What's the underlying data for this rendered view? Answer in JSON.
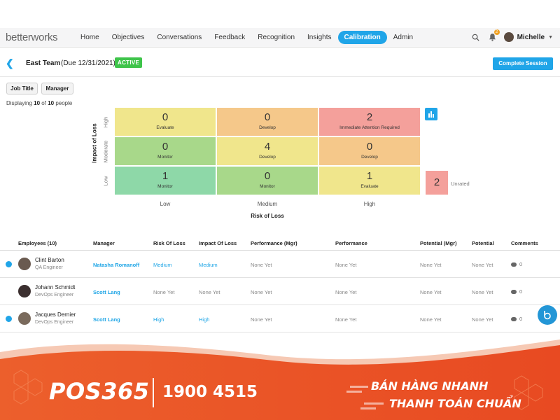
{
  "app": {
    "logo_text": "betterworks"
  },
  "nav": {
    "items": [
      {
        "label": "Home",
        "active": false
      },
      {
        "label": "Objectives",
        "active": false
      },
      {
        "label": "Conversations",
        "active": false
      },
      {
        "label": "Feedback",
        "active": false
      },
      {
        "label": "Recognition",
        "active": false
      },
      {
        "label": "Insights",
        "active": false
      },
      {
        "label": "Calibration",
        "active": true
      },
      {
        "label": "Admin",
        "active": false
      }
    ],
    "notification_count": "2",
    "user_name": "Michelle"
  },
  "session": {
    "team": "East Team",
    "due": "(Due 12/31/2021)",
    "status": "ACTIVE",
    "complete_label": "Complete Session"
  },
  "filters": {
    "job_title": "Job Title",
    "manager": "Manager"
  },
  "displaying": {
    "prefix": "Displaying",
    "shown": "10",
    "of": "of",
    "total": "10",
    "suffix": "people"
  },
  "grid": {
    "y_title": "Impact of Loss",
    "x_title": "Risk of Loss",
    "y_ticks": [
      "High",
      "Moderate",
      "Low"
    ],
    "x_ticks": [
      "Low",
      "Medium",
      "High"
    ],
    "rows": [
      [
        {
          "count": "0",
          "label": "Evaluate",
          "color": "#f0e68c"
        },
        {
          "count": "0",
          "label": "Develop",
          "color": "#f5c88a"
        },
        {
          "count": "2",
          "label": "Immediate Attention Required",
          "color": "#f4a09b"
        }
      ],
      [
        {
          "count": "0",
          "label": "Monitor",
          "color": "#a8d88a"
        },
        {
          "count": "4",
          "label": "Develop",
          "color": "#f0e68c"
        },
        {
          "count": "0",
          "label": "Develop",
          "color": "#f5c88a"
        }
      ],
      [
        {
          "count": "1",
          "label": "Monitor",
          "color": "#8ed8a8"
        },
        {
          "count": "0",
          "label": "Monitor",
          "color": "#a8d88a"
        },
        {
          "count": "1",
          "label": "Evaluate",
          "color": "#f0e68c"
        }
      ]
    ],
    "unrated_count": "2",
    "unrated_label": "Unrated"
  },
  "table": {
    "headers": [
      "Employees (10)",
      "Manager",
      "Risk Of Loss",
      "Impact Of Loss",
      "Performance (Mgr)",
      "Performance",
      "Potential (Mgr)",
      "Potential",
      "Comments"
    ],
    "rows": [
      {
        "checked": true,
        "name": "Clint Barton",
        "role": "QA Engineer",
        "manager": "Natasha Romanoff",
        "risk": "Medium",
        "impact": "Medium",
        "perf_mgr": "None Yet",
        "perf": "None Yet",
        "pot_mgr": "None Yet",
        "pot": "None Yet",
        "comments": "0",
        "avatar_color": "#6a5a50"
      },
      {
        "checked": false,
        "name": "Johann Schmidt",
        "role": "DevOps Engineer",
        "manager": "Scott Lang",
        "risk": "None Yet",
        "impact": "None Yet",
        "perf_mgr": "None Yet",
        "perf": "None Yet",
        "pot_mgr": "None Yet",
        "pot": "None Yet",
        "comments": "0",
        "avatar_color": "#3b2f2f"
      },
      {
        "checked": true,
        "name": "Jacques Dernier",
        "role": "DevOps Engineer",
        "manager": "Scott Lang",
        "risk": "High",
        "impact": "High",
        "perf_mgr": "None Yet",
        "perf": "None Yet",
        "pot_mgr": "None Yet",
        "pot": "None Yet",
        "comments": "0",
        "avatar_color": "#7a6a5c"
      }
    ]
  },
  "banner": {
    "brand": "POS365",
    "phone": "1900 4515",
    "slogan_1": "BÁN HÀNG NHANH",
    "slogan_2": "THANH TOÁN CHUẨN",
    "color": "#e8542a"
  }
}
